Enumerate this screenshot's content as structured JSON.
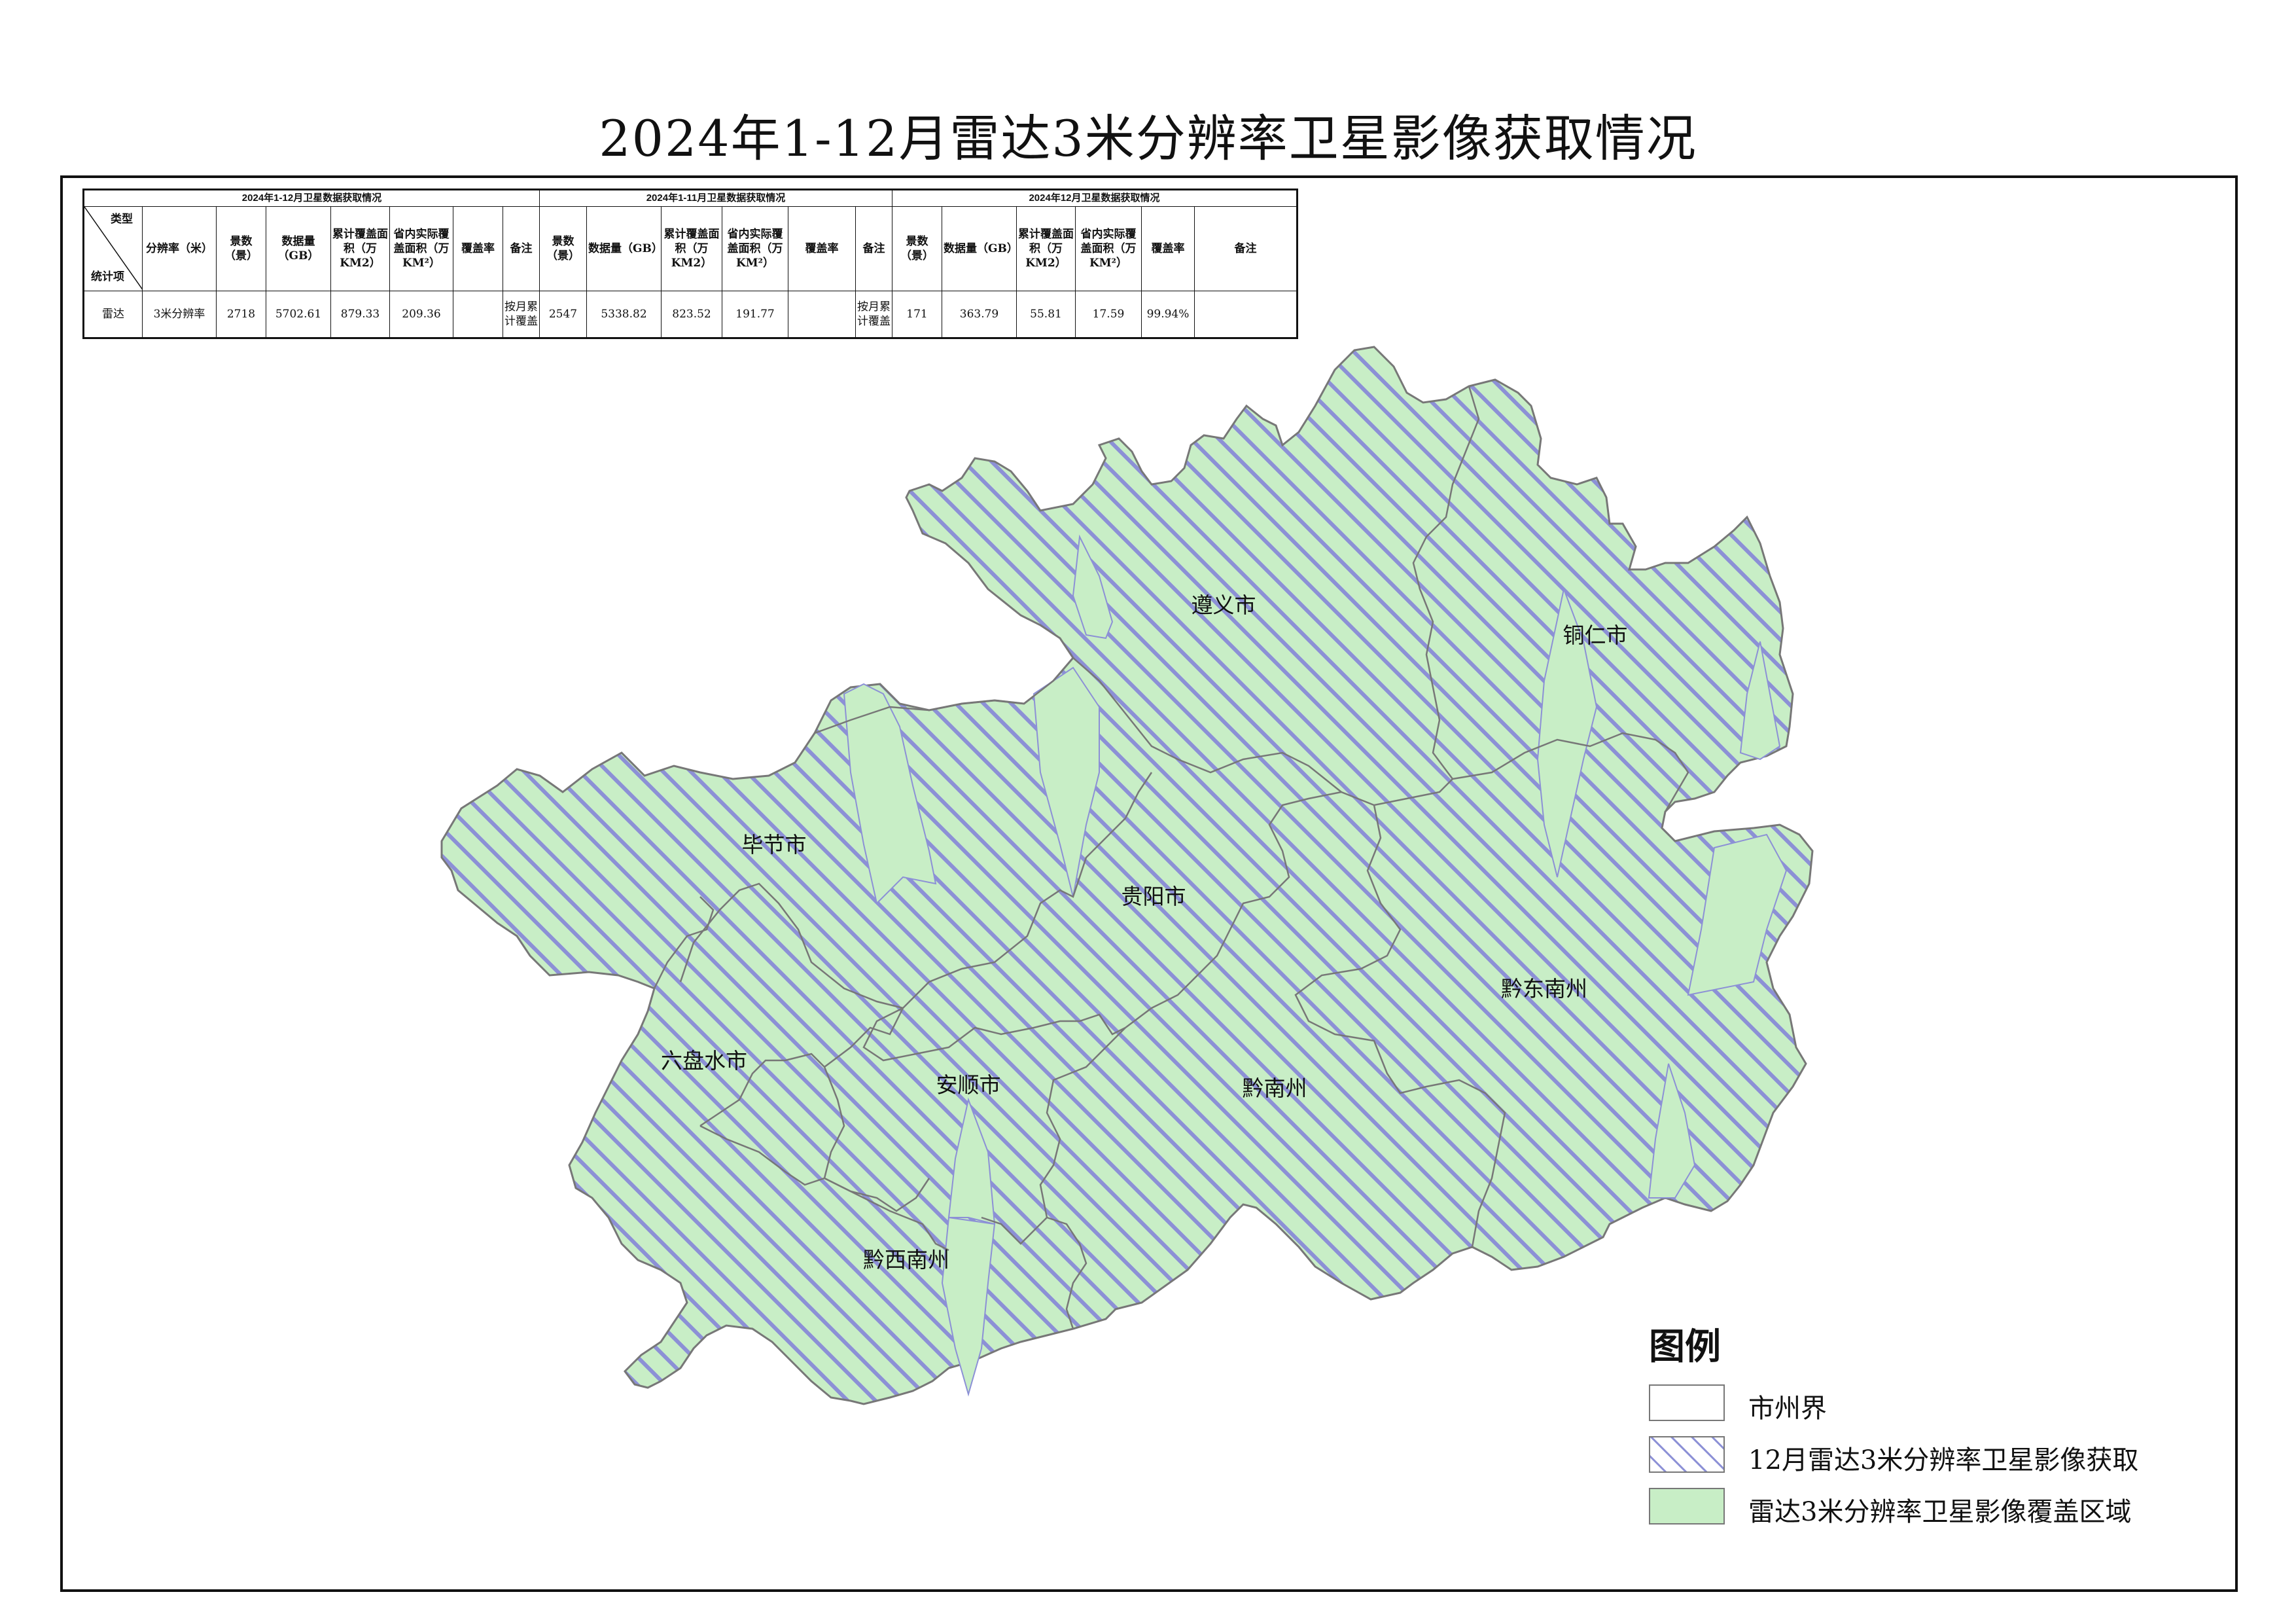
{
  "title": "2024年1-12月雷达3米分辨率卫星影像获取情况",
  "table": {
    "groups": [
      "2024年1-12月卫星数据获取情况",
      "2024年1-11月卫星数据获取情况",
      "2024年12月卫星数据获取情况"
    ],
    "corner_top": "类型",
    "corner_bottom": "统计项",
    "col_resolution": "分辨率（米）",
    "g1_headers": [
      "景数（景）",
      "数据量（GB）",
      "累计覆盖面积（万KM2）",
      "省内实际覆盖面积（万KM²）",
      "覆盖率",
      "备注"
    ],
    "g2_headers": [
      "景数（景）",
      "数据量（GB）",
      "累计覆盖面积（万KM2）",
      "省内实际覆盖面积（万KM²）",
      "覆盖率",
      "备注"
    ],
    "g3_headers": [
      "景数（景）",
      "数据量（GB）",
      "累计覆盖面积（万KM2）",
      "省内实际覆盖面积（万KM²）",
      "覆盖率",
      "备注"
    ],
    "row": {
      "type": "雷达",
      "resolution": "3米分辨率",
      "g1": [
        "2718",
        "5702.61",
        "879.33",
        "209.36",
        "",
        "按月累计覆盖"
      ],
      "g2": [
        "2547",
        "5338.82",
        "823.52",
        "191.77",
        "",
        "按月累计覆盖"
      ],
      "g3": [
        "171",
        "363.79",
        "55.81",
        "17.59",
        "99.94%",
        ""
      ]
    }
  },
  "regions": [
    "遵义市",
    "铜仁市",
    "毕节市",
    "贵阳市",
    "黔东南州",
    "六盘水市",
    "安顺市",
    "黔南州",
    "黔西南州"
  ],
  "legend": {
    "title": "图例",
    "items": [
      "市州界",
      "12月雷达3米分辨率卫星影像获取",
      "雷达3米分辨率卫星影像覆盖区域"
    ]
  },
  "colors": {
    "coverage_fill": "#c8eec6",
    "hatch_stroke": "#8c90d6",
    "boundary": "#777777",
    "frame": "#111111"
  }
}
